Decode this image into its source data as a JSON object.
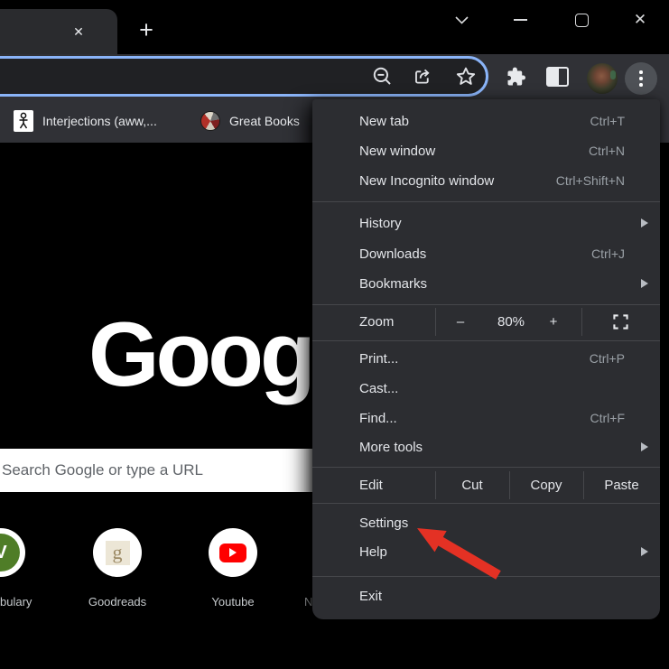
{
  "window": {
    "tab_close_glyph": "✕",
    "new_tab_glyph": "+",
    "close_glyph": "✕"
  },
  "bookmarks_bar": {
    "items": [
      {
        "label": "Interjections (aww,..."
      },
      {
        "label": "Great Books"
      }
    ]
  },
  "new_tab_page": {
    "logo_text": "Google",
    "search_placeholder": "Search Google or type a URL",
    "shortcuts": [
      {
        "label": "bulary"
      },
      {
        "label": "Goodreads"
      },
      {
        "label": "Youtube"
      },
      {
        "label": "N"
      }
    ]
  },
  "menu": {
    "sections": [
      {
        "items": [
          {
            "label": "New tab",
            "shortcut": "Ctrl+T"
          },
          {
            "label": "New window",
            "shortcut": "Ctrl+N"
          },
          {
            "label": "New Incognito window",
            "shortcut": "Ctrl+Shift+N"
          }
        ]
      },
      {
        "items": [
          {
            "label": "History",
            "submenu": true
          },
          {
            "label": "Downloads",
            "shortcut": "Ctrl+J"
          },
          {
            "label": "Bookmarks",
            "submenu": true
          }
        ]
      },
      {
        "zoom": {
          "label": "Zoom",
          "minus": "–",
          "value": "80%",
          "plus": "+"
        }
      },
      {
        "items": [
          {
            "label": "Print...",
            "shortcut": "Ctrl+P"
          },
          {
            "label": "Cast..."
          },
          {
            "label": "Find...",
            "shortcut": "Ctrl+F"
          },
          {
            "label": "More tools",
            "submenu": true
          }
        ]
      },
      {
        "edit": {
          "label": "Edit",
          "cut": "Cut",
          "copy": "Copy",
          "paste": "Paste"
        }
      },
      {
        "items": [
          {
            "label": "Settings"
          },
          {
            "label": "Help",
            "submenu": true
          }
        ]
      },
      {
        "items": [
          {
            "label": "Exit"
          }
        ]
      }
    ]
  },
  "colors": {
    "focus_blue": "#8ab4f8",
    "arrow_red": "#e43124",
    "toolbar_bg": "#303136",
    "menu_bg": "#2c2d31",
    "youtube_red": "#ff0000",
    "vocabulary_green": "#4f7d27"
  }
}
